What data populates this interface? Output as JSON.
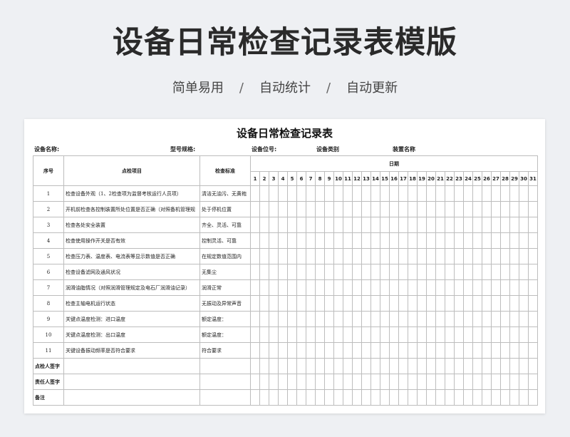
{
  "banner": {
    "title": "设备日常检查记录表模版",
    "features": [
      "简单易用",
      "自动统计",
      "自动更新"
    ],
    "separator": "/"
  },
  "sheet": {
    "title": "设备日常检查记录表",
    "meta": {
      "equipment_name": "设备名称:",
      "model_spec": "型号规格:",
      "equipment_position": "设备位号:",
      "equipment_category": "设备类别",
      "device_name": "装置名称"
    },
    "headers": {
      "no": "序号",
      "item": "点检项目",
      "standard": "检查标准",
      "date": "日期"
    },
    "days": [
      "1",
      "2",
      "3",
      "4",
      "5",
      "6",
      "7",
      "8",
      "9",
      "10",
      "11",
      "12",
      "13",
      "14",
      "15",
      "16",
      "17",
      "18",
      "19",
      "20",
      "21",
      "22",
      "23",
      "24",
      "25",
      "26",
      "27",
      "28",
      "29",
      "30",
      "31"
    ],
    "rows": [
      {
        "no": "1",
        "item": "检查设备外观（1、2检查项为监督考核运行人员项）",
        "standard": "清洁无油污、无黄袍"
      },
      {
        "no": "2",
        "item": "开机前检查各控制装置所处位置是否正确（对照备机管理规",
        "standard": "处于停机位置"
      },
      {
        "no": "3",
        "item": "检查各处安全装置",
        "standard": "齐全、灵活、可靠"
      },
      {
        "no": "4",
        "item": "检查使用操作开关是否有效",
        "standard": "控制灵活、可靠"
      },
      {
        "no": "5",
        "item": "检查压力表、温度表、电流表等显示数值是否正确",
        "standard": "在规定数值范围内"
      },
      {
        "no": "6",
        "item": "检查设备滤网及通风状况",
        "standard": "无集尘"
      },
      {
        "no": "7",
        "item": "润滑油脂情况（对照润滑管理规定及电石厂润滑油记录）",
        "standard": "润滑正常"
      },
      {
        "no": "8",
        "item": "检查主轴电机运行状态",
        "standard": "无振动及异常声音"
      },
      {
        "no": "9",
        "item": "关键点温度检测：进口温度",
        "standard": "额定温度："
      },
      {
        "no": "10",
        "item": "关键点温度检测：出口温度",
        "standard": "额定温度："
      },
      {
        "no": "11",
        "item": "关键设备振动频率是否符合要求",
        "standard": "符合要求"
      }
    ],
    "footer": {
      "inspector": "点检人签字",
      "responsible": "责任人签字",
      "remarks": "备注"
    }
  }
}
